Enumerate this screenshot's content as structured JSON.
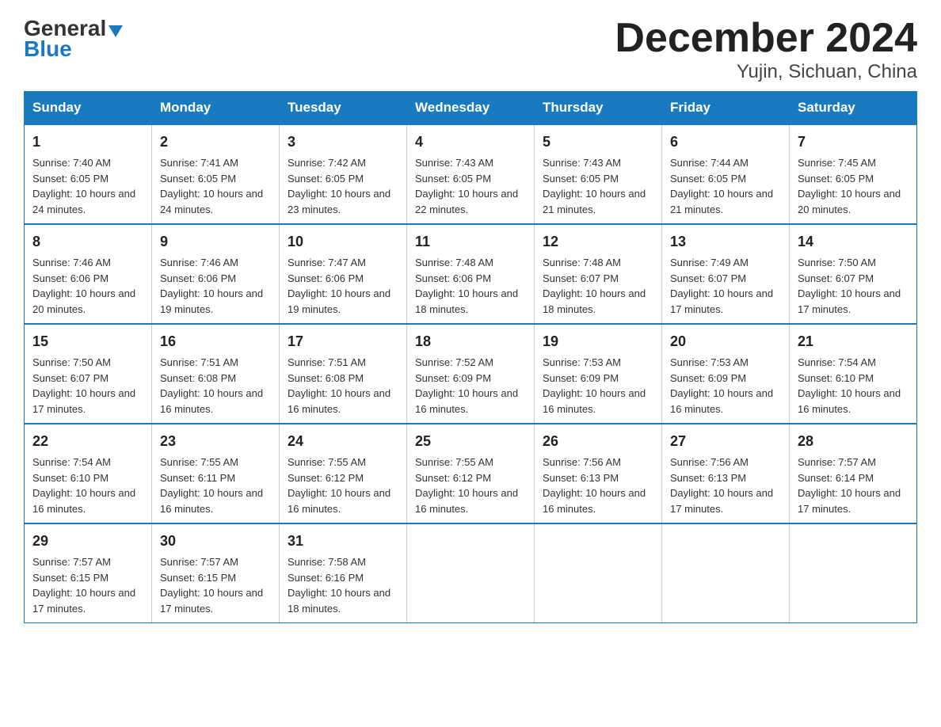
{
  "logo": {
    "general": "General",
    "blue": "Blue"
  },
  "title": "December 2024",
  "subtitle": "Yujin, Sichuan, China",
  "days": [
    "Sunday",
    "Monday",
    "Tuesday",
    "Wednesday",
    "Thursday",
    "Friday",
    "Saturday"
  ],
  "weeks": [
    [
      {
        "num": "1",
        "sunrise": "7:40 AM",
        "sunset": "6:05 PM",
        "daylight": "10 hours and 24 minutes."
      },
      {
        "num": "2",
        "sunrise": "7:41 AM",
        "sunset": "6:05 PM",
        "daylight": "10 hours and 24 minutes."
      },
      {
        "num": "3",
        "sunrise": "7:42 AM",
        "sunset": "6:05 PM",
        "daylight": "10 hours and 23 minutes."
      },
      {
        "num": "4",
        "sunrise": "7:43 AM",
        "sunset": "6:05 PM",
        "daylight": "10 hours and 22 minutes."
      },
      {
        "num": "5",
        "sunrise": "7:43 AM",
        "sunset": "6:05 PM",
        "daylight": "10 hours and 21 minutes."
      },
      {
        "num": "6",
        "sunrise": "7:44 AM",
        "sunset": "6:05 PM",
        "daylight": "10 hours and 21 minutes."
      },
      {
        "num": "7",
        "sunrise": "7:45 AM",
        "sunset": "6:05 PM",
        "daylight": "10 hours and 20 minutes."
      }
    ],
    [
      {
        "num": "8",
        "sunrise": "7:46 AM",
        "sunset": "6:06 PM",
        "daylight": "10 hours and 20 minutes."
      },
      {
        "num": "9",
        "sunrise": "7:46 AM",
        "sunset": "6:06 PM",
        "daylight": "10 hours and 19 minutes."
      },
      {
        "num": "10",
        "sunrise": "7:47 AM",
        "sunset": "6:06 PM",
        "daylight": "10 hours and 19 minutes."
      },
      {
        "num": "11",
        "sunrise": "7:48 AM",
        "sunset": "6:06 PM",
        "daylight": "10 hours and 18 minutes."
      },
      {
        "num": "12",
        "sunrise": "7:48 AM",
        "sunset": "6:07 PM",
        "daylight": "10 hours and 18 minutes."
      },
      {
        "num": "13",
        "sunrise": "7:49 AM",
        "sunset": "6:07 PM",
        "daylight": "10 hours and 17 minutes."
      },
      {
        "num": "14",
        "sunrise": "7:50 AM",
        "sunset": "6:07 PM",
        "daylight": "10 hours and 17 minutes."
      }
    ],
    [
      {
        "num": "15",
        "sunrise": "7:50 AM",
        "sunset": "6:07 PM",
        "daylight": "10 hours and 17 minutes."
      },
      {
        "num": "16",
        "sunrise": "7:51 AM",
        "sunset": "6:08 PM",
        "daylight": "10 hours and 16 minutes."
      },
      {
        "num": "17",
        "sunrise": "7:51 AM",
        "sunset": "6:08 PM",
        "daylight": "10 hours and 16 minutes."
      },
      {
        "num": "18",
        "sunrise": "7:52 AM",
        "sunset": "6:09 PM",
        "daylight": "10 hours and 16 minutes."
      },
      {
        "num": "19",
        "sunrise": "7:53 AM",
        "sunset": "6:09 PM",
        "daylight": "10 hours and 16 minutes."
      },
      {
        "num": "20",
        "sunrise": "7:53 AM",
        "sunset": "6:09 PM",
        "daylight": "10 hours and 16 minutes."
      },
      {
        "num": "21",
        "sunrise": "7:54 AM",
        "sunset": "6:10 PM",
        "daylight": "10 hours and 16 minutes."
      }
    ],
    [
      {
        "num": "22",
        "sunrise": "7:54 AM",
        "sunset": "6:10 PM",
        "daylight": "10 hours and 16 minutes."
      },
      {
        "num": "23",
        "sunrise": "7:55 AM",
        "sunset": "6:11 PM",
        "daylight": "10 hours and 16 minutes."
      },
      {
        "num": "24",
        "sunrise": "7:55 AM",
        "sunset": "6:12 PM",
        "daylight": "10 hours and 16 minutes."
      },
      {
        "num": "25",
        "sunrise": "7:55 AM",
        "sunset": "6:12 PM",
        "daylight": "10 hours and 16 minutes."
      },
      {
        "num": "26",
        "sunrise": "7:56 AM",
        "sunset": "6:13 PM",
        "daylight": "10 hours and 16 minutes."
      },
      {
        "num": "27",
        "sunrise": "7:56 AM",
        "sunset": "6:13 PM",
        "daylight": "10 hours and 17 minutes."
      },
      {
        "num": "28",
        "sunrise": "7:57 AM",
        "sunset": "6:14 PM",
        "daylight": "10 hours and 17 minutes."
      }
    ],
    [
      {
        "num": "29",
        "sunrise": "7:57 AM",
        "sunset": "6:15 PM",
        "daylight": "10 hours and 17 minutes."
      },
      {
        "num": "30",
        "sunrise": "7:57 AM",
        "sunset": "6:15 PM",
        "daylight": "10 hours and 17 minutes."
      },
      {
        "num": "31",
        "sunrise": "7:58 AM",
        "sunset": "6:16 PM",
        "daylight": "10 hours and 18 minutes."
      },
      null,
      null,
      null,
      null
    ]
  ]
}
